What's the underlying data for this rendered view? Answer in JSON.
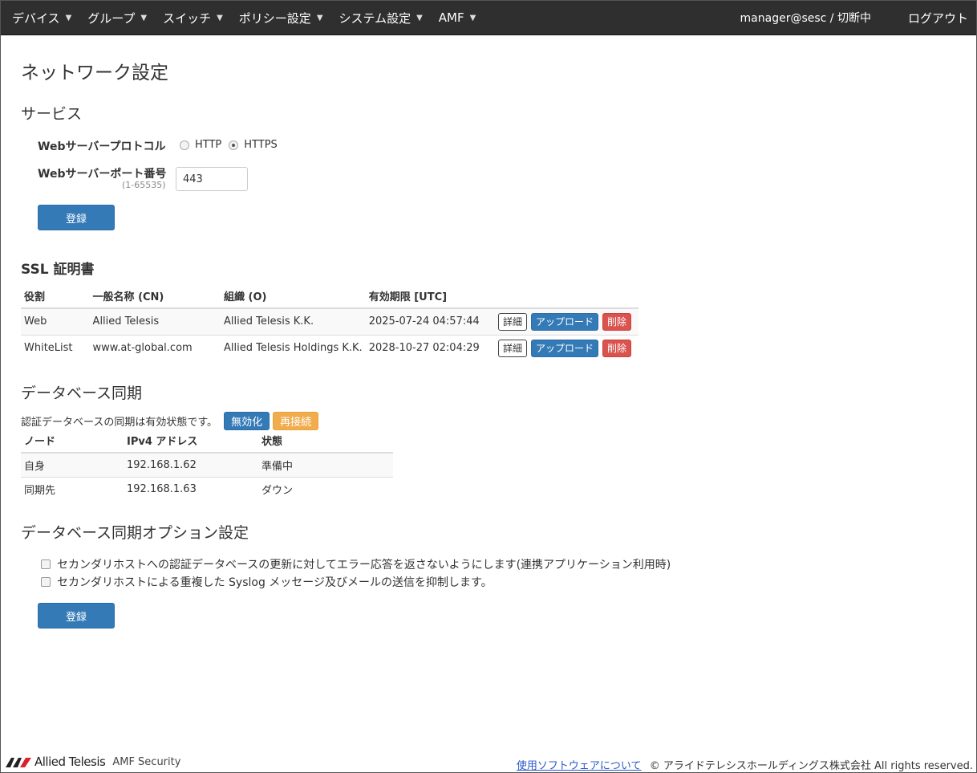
{
  "nav": {
    "items": [
      "デバイス",
      "グループ",
      "スイッチ",
      "ポリシー設定",
      "システム設定",
      "AMF"
    ],
    "user": "manager@sesc / 切断中",
    "logout": "ログアウト"
  },
  "page_title": "ネットワーク設定",
  "service": {
    "heading": "サービス",
    "protocol_label": "Webサーバープロトコル",
    "protocol_options": [
      "HTTP",
      "HTTPS"
    ],
    "protocol_selected": "HTTPS",
    "port_label": "Webサーバーポート番号",
    "port_range": "(1-65535)",
    "port_value": "443",
    "submit_label": "登録"
  },
  "ssl": {
    "heading": "SSL 証明書",
    "columns": [
      "役割",
      "一般名称 (CN)",
      "組織 (O)",
      "有効期限 [UTC]"
    ],
    "rows": [
      {
        "role": "Web",
        "cn": "Allied Telesis",
        "org": "Allied Telesis K.K.",
        "expiry": "2025-07-24 04:57:44"
      },
      {
        "role": "WhiteList",
        "cn": "www.at-global.com",
        "org": "Allied Telesis Holdings K.K.",
        "expiry": "2028-10-27 02:04:29"
      }
    ],
    "btn_detail": "詳細",
    "btn_upload": "アップロード",
    "btn_delete": "削除"
  },
  "dbsync": {
    "heading": "データベース同期",
    "status_text": "認証データベースの同期は有効状態です。",
    "btn_disable": "無効化",
    "btn_reconnect": "再接続",
    "columns": [
      "ノード",
      "IPv4 アドレス",
      "状態"
    ],
    "rows": [
      {
        "node": "自身",
        "ip": "192.168.1.62",
        "state": "準備中"
      },
      {
        "node": "同期先",
        "ip": "192.168.1.63",
        "state": "ダウン"
      }
    ]
  },
  "dbsync_options": {
    "heading": "データベース同期オプション設定",
    "options": [
      "セカンダリホストへの認証データベースの更新に対してエラー応答を返さないようにします(連携アプリケーション利用時)",
      "セカンダリホストによる重複した Syslog メッセージ及びメールの送信を抑制します。"
    ],
    "submit_label": "登録"
  },
  "footer": {
    "logo_text": "Allied Telesis",
    "product": "AMF Security",
    "link": "使用ソフトウェアについて",
    "copyright": "© アライドテレシスホールディングス株式会社 All rights reserved."
  }
}
